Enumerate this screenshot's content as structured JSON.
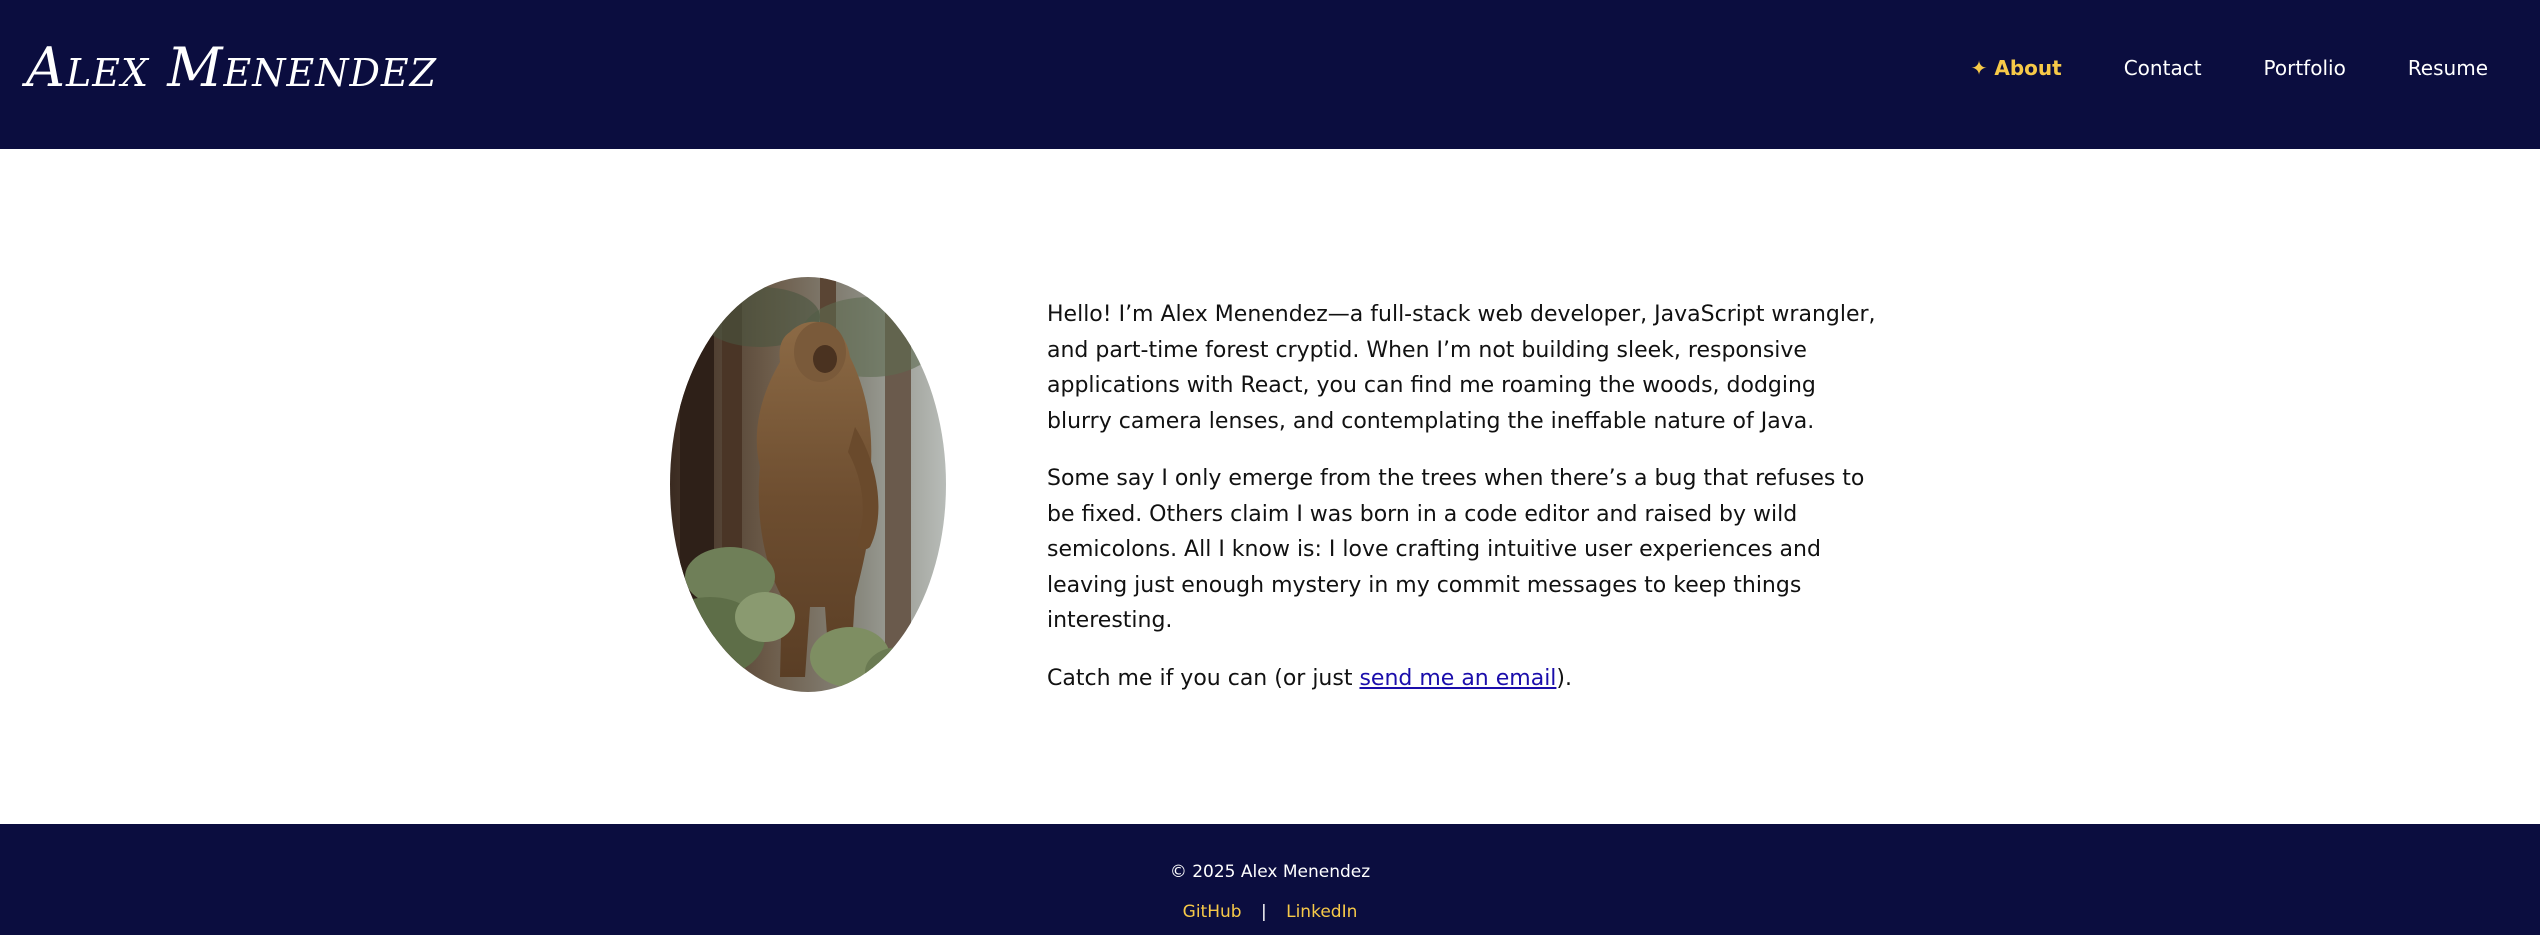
{
  "header": {
    "brand": "Alex Menendez",
    "nav": [
      {
        "label": "✦ About",
        "active": true
      },
      {
        "label": "Contact"
      },
      {
        "label": "Portfolio"
      },
      {
        "label": "Resume"
      }
    ]
  },
  "main": {
    "avatar_alt": "Bigfoot standing in a forest",
    "paragraphs": [
      "Hello! I’m Alex Menendez—a full-stack web developer, JavaScript wrangler, and part-time forest cryptid. When I’m not building sleek, responsive applications with React, you can find me roaming the woods, dodging blurry camera lenses, and contemplating the ineffable nature of Java.",
      "Some say I only emerge from the trees when there’s a bug that refuses to be fixed. Others claim I was born in a code editor and raised by wild semicolons. All I know is: I love crafting intuitive user experiences and leaving just enough mystery in my commit messages to keep things interesting."
    ],
    "cta": {
      "before": "Catch me if you can (or just ",
      "link": "send me an email",
      "after": ")."
    }
  },
  "footer": {
    "copyright": "© 2025 Alex Menendez",
    "links": [
      "GitHub",
      "LinkedIn"
    ],
    "separator": "|"
  },
  "colors": {
    "navy": "#0b0d3f",
    "accent": "#f7c948",
    "link": "#1a0dab"
  }
}
